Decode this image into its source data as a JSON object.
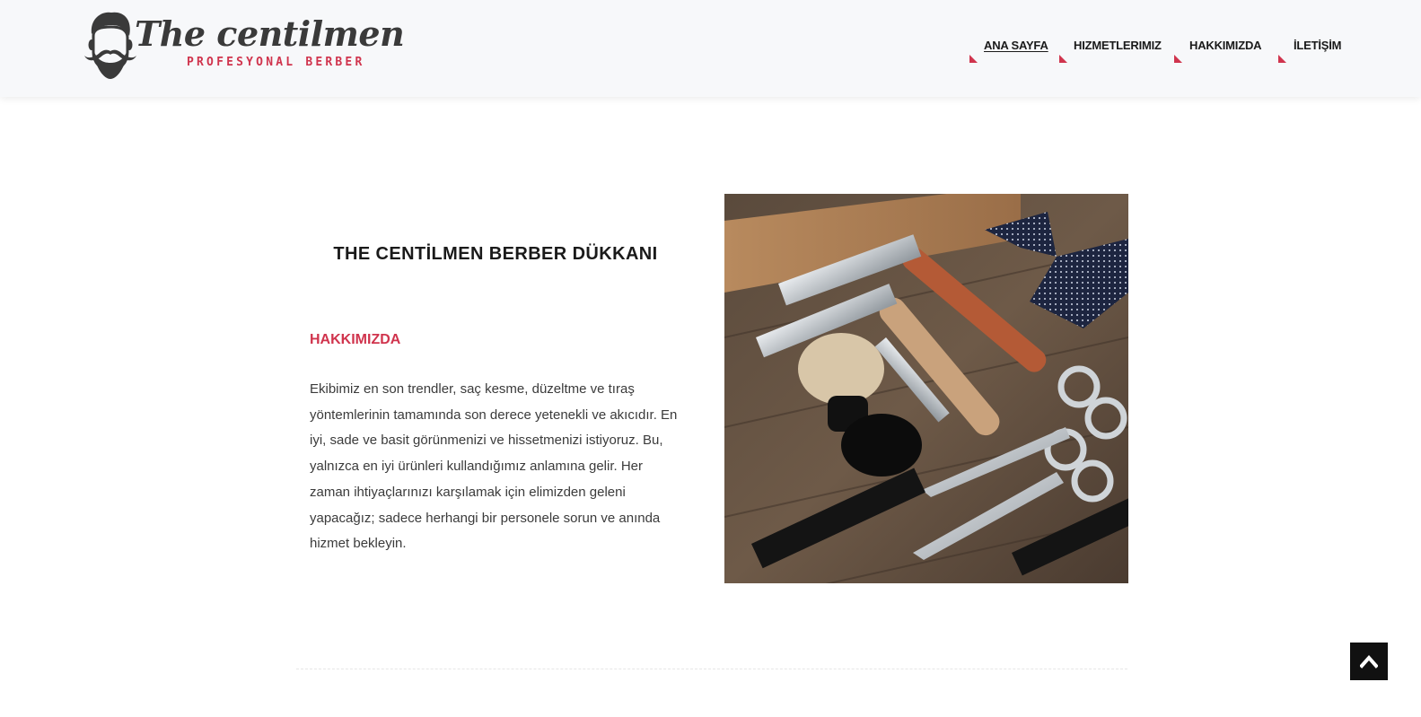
{
  "brand": {
    "name": "The centilmen",
    "tagline": "PROFESYONAL BERBER",
    "accent_color": "#d0344d",
    "logo_icon": "mustache-man-icon"
  },
  "nav": {
    "items": [
      {
        "label": "ANA SAYFA",
        "active": true
      },
      {
        "label": "HIZMETLERIMIZ",
        "active": false
      },
      {
        "label": "HAKKIMIZDA",
        "active": false
      },
      {
        "label": "İLETİŞİM",
        "active": false
      }
    ]
  },
  "main": {
    "title": "THE CENTİLMEN BERBER DÜKKANI",
    "about_heading": "HAKKIMIZDA",
    "about_text": "Ekibimiz en son trendler, saç kesme, düzeltme ve tıraş yöntemlerinin tamamında son derece yetenekli ve akıcıdır. En iyi, sade ve basit görünmenizi ve hissetmenizi istiyoruz. Bu, yalnızca en iyi ürünleri kullandığımız anlamına gelir. Her zaman ihtiyaçlarınızı karşılamak için elimizden geleni yapacağız; sadece herhangi bir personele sorun ve anında hizmet bekleyin.",
    "image_subject": "barber-tools-photo"
  },
  "scroll_top": {
    "icon": "chevron-up-icon"
  }
}
